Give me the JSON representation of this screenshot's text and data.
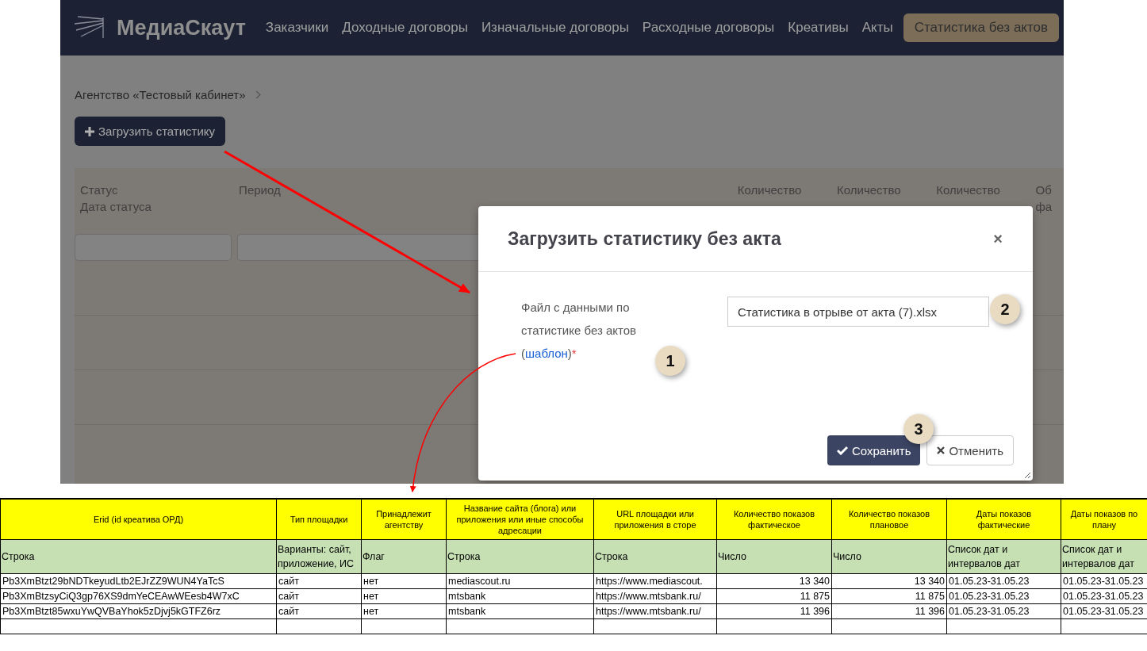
{
  "app": {
    "logo": "МедиаСкаут",
    "nav": [
      {
        "label": "Заказчики",
        "selected": false
      },
      {
        "label": "Доходные договоры",
        "selected": false
      },
      {
        "label": "Изначальные договоры",
        "selected": false
      },
      {
        "label": "Расходные договоры",
        "selected": false
      },
      {
        "label": "Креативы",
        "selected": false
      },
      {
        "label": "Акты",
        "selected": false
      },
      {
        "label": "Статистика без актов",
        "selected": true
      }
    ],
    "breadcrumb": "Агентство «Тестовый кабинет»",
    "upload_button": "Загрузить статистику",
    "columns": [
      {
        "lines": [
          "Статус",
          "Дата статуса"
        ]
      },
      {
        "lines": [
          "Период"
        ]
      },
      {
        "lines": [
          "Количество"
        ]
      },
      {
        "lines": [
          "Количество"
        ]
      },
      {
        "lines": [
          "Количество"
        ]
      },
      {
        "lines": [
          "Об",
          "фа"
        ]
      }
    ]
  },
  "modal": {
    "title": "Загрузить статистику без акта",
    "close": "×",
    "label_before": "Файл с данными по статистике без актов (",
    "link": "шаблон",
    "label_after": ")",
    "required_mark": "*",
    "file_value": "Статистика в отрыве от акта (7).xlsx",
    "buttons": [
      {
        "kind": "primary",
        "label": "Сохранить"
      },
      {
        "kind": "secondary",
        "label": "Отменить"
      }
    ]
  },
  "callouts": [
    "1",
    "2",
    "3"
  ],
  "sheet": {
    "columns": [
      {
        "title": "Erid (id креатива ОРД)",
        "type": "Строка",
        "numeric": false
      },
      {
        "title": "Тип площадки",
        "type": "Варианты: сайт, приложение, ИС",
        "numeric": false
      },
      {
        "title": "Принадлежит агентству",
        "type": "Флаг",
        "numeric": false
      },
      {
        "title": "Название сайта (блога) или приложения или иные способы адресации",
        "type": "Строка",
        "numeric": false
      },
      {
        "title": "URL площадки или приложения в сторе",
        "type": "Строка",
        "numeric": false
      },
      {
        "title": "Количество показов фактическое",
        "type": "Число",
        "numeric": true
      },
      {
        "title": "Количество показов плановое",
        "type": "Число",
        "numeric": true
      },
      {
        "title": "Даты показов фактические",
        "type": "Список дат и интервалов дат",
        "numeric": false
      },
      {
        "title": "Даты показов по плану",
        "type": "Список дат и интервалов дат",
        "numeric": false
      }
    ],
    "rows": [
      [
        "Pb3XmBtzt29bNDTkeyudLtb2EJrZZ9WUN4YaTcS",
        "сайт",
        "нет",
        "mediascout.ru",
        "https://www.mediascout.",
        "13 340",
        "13 340",
        "01.05.23-31.05.23",
        "01.05.23-31.05.23"
      ],
      [
        "Pb3XmBtzsyCiQ3gp76XS9dmYeCEAwWEesb4W7xC",
        "сайт",
        "нет",
        "mtsbank",
        "https://www.mtsbank.ru/",
        "11 875",
        "11 875",
        "01.05.23-31.05.23",
        "01.05.23-31.05.23"
      ],
      [
        "Pb3XmBtzt85wxuYwQVBaYhok5zDjvj5kGTFZ6rz",
        "сайт",
        "нет",
        "mtsbank",
        "https://www.mtsbank.ru/",
        "11 396",
        "11 396",
        "01.05.23-31.05.23",
        "01.05.23-31.05.23"
      ]
    ]
  }
}
